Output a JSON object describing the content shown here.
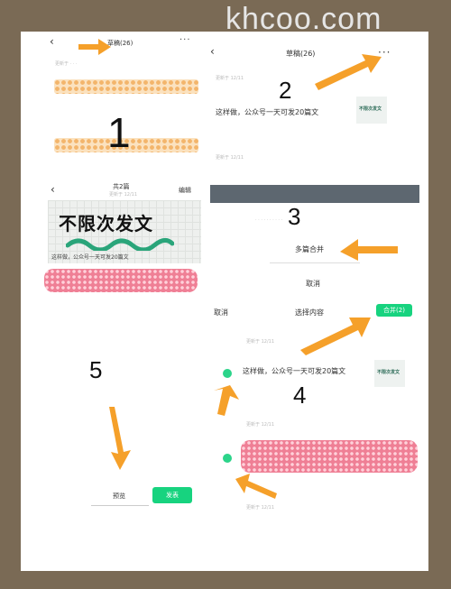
{
  "watermark": "khcoo.com",
  "step_numbers": [
    "1",
    "2",
    "3",
    "4",
    "5"
  ],
  "panel1": {
    "title": "草稿(26)",
    "more": "···"
  },
  "panel1b": {
    "header": "共2篇",
    "sub": "更新于 12/11",
    "edit": "编辑",
    "banner": "不限次发文",
    "caption": "这样做，公众号一天可发20篇文"
  },
  "panel2": {
    "title": "草稿(26)",
    "more": "···",
    "article": "这样做，公众号一天可发20篇文",
    "faint_date": "更新于 12/11"
  },
  "panel3": {
    "merge": "多篇合并",
    "cancel": "取消"
  },
  "panel4": {
    "cancel": "取消",
    "title": "选择内容",
    "merge_btn": "合并(2)",
    "article": "这样做，公众号一天可发20篇文",
    "thumb_text": "不限次发文",
    "faint": "更新于 12/11"
  },
  "panel5": {
    "preview": "预览",
    "publish": "发表"
  }
}
